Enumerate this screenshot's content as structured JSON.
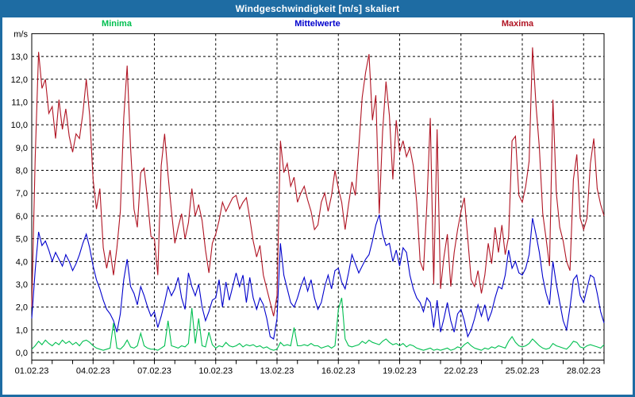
{
  "window": {
    "title": "Windgeschwindigkeit [m/s] skaliert"
  },
  "colors": {
    "titlebar_bg": "#1e6ca3",
    "window_border": "#1e6ca3",
    "plot_bg": "#ffffff",
    "grid": "#000000",
    "axis_text": "#000000",
    "minima": "#00bf50",
    "mittelwerte": "#0000cc",
    "maxima": "#b01423"
  },
  "axes": {
    "unit_label": "m/s",
    "y_tick_labels": [
      "0,0",
      "1,0",
      "2,0",
      "3,0",
      "4,0",
      "5,0",
      "6,0",
      "7,0",
      "8,0",
      "9,0",
      "10,0",
      "11,0",
      "12,0",
      "13,0"
    ],
    "x_tick_days": [
      0,
      3,
      6,
      9,
      12,
      15,
      18,
      21,
      24,
      27
    ],
    "x_tick_labels": [
      "01.02.23",
      "04.02.23",
      "07.02.23",
      "10.02.23",
      "13.02.23",
      "16.02.23",
      "19.02.23",
      "22.02.23",
      "25.02.23",
      "28.02.23"
    ],
    "days_total": 28
  },
  "chart_data": {
    "type": "line",
    "title": "Windgeschwindigkeit [m/s] skaliert",
    "xlabel": "",
    "ylabel": "m/s",
    "x_start": "01.02.23",
    "x_end": "01.03.23",
    "sample_interval_hours": 4,
    "ylim": [
      -0.33,
      14
    ],
    "y_gridlines": [
      0,
      1,
      2,
      3,
      4,
      5,
      6,
      7,
      8,
      9,
      10,
      11,
      12,
      13,
      14
    ],
    "x_gridline_days": [
      3,
      6,
      9,
      12,
      15,
      18,
      21,
      24,
      27
    ],
    "grid": "dashed",
    "legend_position": "top",
    "series": [
      {
        "name": "Minima",
        "color": "#00bf50",
        "values": [
          0.15,
          0.3,
          0.5,
          0.35,
          0.55,
          0.4,
          0.3,
          0.45,
          0.35,
          0.55,
          0.4,
          0.5,
          0.35,
          0.45,
          0.3,
          0.5,
          0.55,
          0.45,
          0.3,
          0.2,
          0.15,
          0.1,
          0.15,
          0.2,
          1.3,
          0.2,
          0.15,
          0.3,
          0.55,
          0.25,
          0.2,
          0.3,
          0.85,
          0.3,
          0.2,
          0.15,
          0.15,
          0.1,
          0.2,
          0.3,
          1.4,
          0.3,
          0.25,
          0.2,
          0.3,
          0.25,
          0.4,
          1.95,
          0.4,
          1.5,
          0.3,
          0.25,
          0.9,
          0.35,
          0.2,
          0.3,
          0.25,
          0.45,
          0.3,
          0.25,
          0.3,
          0.4,
          0.25,
          0.35,
          0.3,
          0.35,
          0.25,
          0.3,
          0.2,
          0.25,
          0.15,
          0.1,
          0.15,
          0.45,
          0.3,
          0.35,
          0.3,
          1.1,
          0.3,
          0.3,
          0.35,
          0.3,
          0.4,
          0.3,
          0.3,
          0.2,
          0.25,
          0.3,
          0.2,
          0.3,
          1.9,
          2.4,
          0.6,
          0.3,
          0.25,
          0.3,
          0.35,
          0.5,
          0.4,
          0.55,
          0.45,
          0.4,
          0.35,
          0.5,
          0.6,
          0.45,
          0.35,
          0.4,
          0.3,
          0.4,
          0.25,
          0.35,
          0.3,
          0.2,
          0.15,
          0.1,
          0.15,
          0.2,
          0.1,
          0.15,
          0.1,
          0.15,
          0.2,
          0.1,
          0.15,
          0.25,
          0.2,
          0.35,
          0.45,
          0.3,
          0.2,
          0.15,
          0.1,
          0.2,
          0.15,
          0.25,
          0.2,
          0.3,
          0.25,
          0.2,
          0.5,
          0.7,
          0.45,
          0.3,
          0.25,
          0.3,
          0.4,
          0.6,
          0.45,
          0.3,
          0.2,
          0.15,
          0.2,
          0.4,
          0.3,
          0.25,
          0.2,
          0.15,
          0.3,
          0.5,
          0.45,
          0.25,
          0.2,
          0.3,
          0.35,
          0.3,
          0.25,
          0.2,
          0.35
        ]
      },
      {
        "name": "Mittelwerte",
        "color": "#0000cc",
        "values": [
          1.5,
          3.6,
          5.3,
          4.7,
          4.9,
          4.5,
          4.0,
          4.4,
          4.1,
          3.8,
          4.3,
          4.0,
          3.6,
          3.9,
          4.3,
          4.8,
          5.2,
          4.6,
          3.8,
          3.2,
          2.8,
          2.3,
          1.9,
          1.7,
          1.4,
          0.9,
          1.7,
          3.2,
          4.1,
          2.9,
          2.6,
          2.1,
          2.9,
          2.5,
          2.0,
          1.6,
          1.8,
          1.1,
          1.6,
          2.2,
          2.9,
          2.5,
          2.8,
          3.3,
          2.4,
          1.9,
          3.5,
          2.9,
          2.5,
          3.0,
          2.0,
          1.4,
          1.8,
          2.3,
          2.4,
          3.2,
          2.0,
          3.1,
          2.3,
          2.9,
          3.5,
          2.9,
          3.4,
          2.2,
          3.3,
          2.4,
          1.9,
          2.4,
          2.1,
          1.5,
          0.7,
          0.6,
          1.5,
          4.8,
          3.4,
          2.8,
          2.2,
          2.0,
          2.4,
          2.9,
          3.3,
          2.7,
          3.2,
          2.4,
          1.9,
          2.2,
          2.9,
          3.4,
          2.8,
          3.6,
          3.7,
          3.1,
          2.8,
          3.5,
          4.3,
          3.9,
          3.5,
          3.8,
          4.1,
          4.3,
          4.9,
          5.6,
          6.05,
          5.2,
          4.7,
          4.8,
          4.0,
          4.5,
          3.8,
          4.6,
          4.4,
          3.4,
          2.8,
          2.4,
          2.2,
          1.8,
          2.4,
          2.2,
          1.1,
          2.3,
          0.9,
          1.5,
          2.2,
          1.4,
          0.9,
          1.7,
          1.9,
          1.4,
          0.7,
          1.0,
          1.5,
          2.1,
          1.6,
          2.1,
          1.4,
          1.8,
          2.4,
          2.9,
          2.8,
          3.4,
          4.5,
          3.7,
          4.0,
          3.5,
          3.4,
          3.7,
          4.3,
          5.9,
          5.2,
          4.4,
          3.3,
          2.6,
          2.1,
          4.0,
          3.0,
          2.2,
          1.4,
          1.0,
          2.0,
          3.2,
          3.4,
          2.5,
          2.2,
          2.8,
          3.4,
          3.3,
          2.6,
          1.8,
          1.3
        ]
      },
      {
        "name": "Maxima",
        "color": "#b01423",
        "values": [
          2.0,
          8.5,
          13.2,
          11.6,
          12.0,
          10.5,
          10.8,
          9.4,
          11.1,
          9.8,
          10.7,
          9.5,
          8.8,
          9.6,
          9.4,
          10.5,
          12.0,
          10.4,
          7.6,
          6.3,
          7.2,
          4.6,
          3.7,
          4.5,
          3.4,
          4.6,
          6.2,
          10.3,
          12.6,
          9.0,
          6.3,
          5.5,
          7.9,
          8.1,
          6.7,
          5.1,
          5.0,
          3.4,
          8.2,
          9.6,
          7.8,
          6.2,
          4.8,
          5.5,
          6.1,
          5.0,
          5.7,
          7.2,
          6.0,
          6.5,
          5.8,
          4.5,
          3.5,
          4.8,
          5.2,
          5.8,
          6.6,
          6.2,
          6.5,
          6.8,
          6.9,
          6.3,
          6.6,
          6.8,
          5.9,
          4.9,
          4.2,
          4.7,
          3.4,
          2.8,
          2.2,
          1.6,
          2.5,
          9.3,
          7.9,
          8.3,
          7.3,
          7.7,
          6.6,
          7.0,
          7.3,
          6.7,
          6.2,
          5.4,
          5.6,
          6.6,
          7.0,
          6.2,
          6.9,
          8.0,
          7.2,
          6.6,
          5.4,
          6.5,
          7.5,
          6.9,
          9.0,
          11.2,
          12.3,
          13.1,
          10.2,
          11.3,
          6.1,
          9.7,
          11.9,
          10.4,
          7.6,
          10.2,
          8.8,
          9.3,
          8.6,
          9.0,
          8.2,
          6.6,
          4.0,
          3.6,
          6.5,
          10.3,
          3.0,
          9.8,
          2.8,
          4.2,
          5.2,
          2.9,
          4.4,
          5.4,
          6.2,
          6.8,
          5.0,
          3.2,
          2.9,
          3.6,
          2.6,
          3.4,
          4.8,
          3.9,
          5.5,
          4.4,
          5.6,
          4.3,
          5.1,
          9.3,
          9.5,
          6.9,
          6.6,
          7.3,
          8.4,
          13.4,
          10.9,
          9.0,
          6.1,
          5.0,
          3.8,
          11.1,
          7.0,
          5.5,
          4.9,
          4.0,
          3.6,
          7.6,
          8.7,
          5.9,
          5.4,
          5.9,
          8.3,
          9.4,
          7.2,
          6.5,
          6.0
        ]
      }
    ]
  }
}
